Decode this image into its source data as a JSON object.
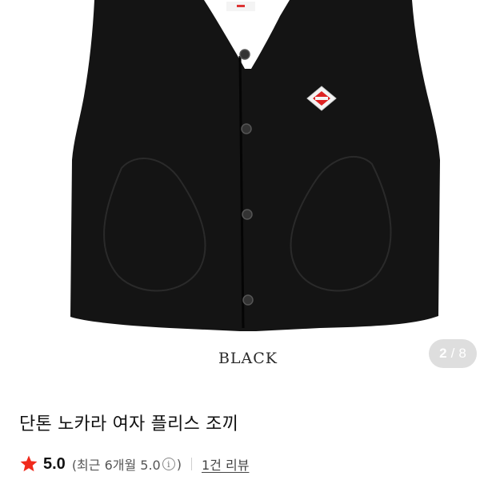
{
  "gallery": {
    "caption": "BLACK",
    "counter": {
      "current": "2",
      "separator": "/",
      "total": "8"
    }
  },
  "product": {
    "title": "단톤 노카라 여자 플리스 조끼",
    "rating": {
      "score": "5.0",
      "recent_open": "(최근 6개월 5.0",
      "info_symbol": "i",
      "recent_close": ")",
      "reviews": "1건 리뷰"
    }
  },
  "colors": {
    "star": "#f02a1c",
    "vest": "#141414",
    "counter_bg": "#dedede"
  }
}
